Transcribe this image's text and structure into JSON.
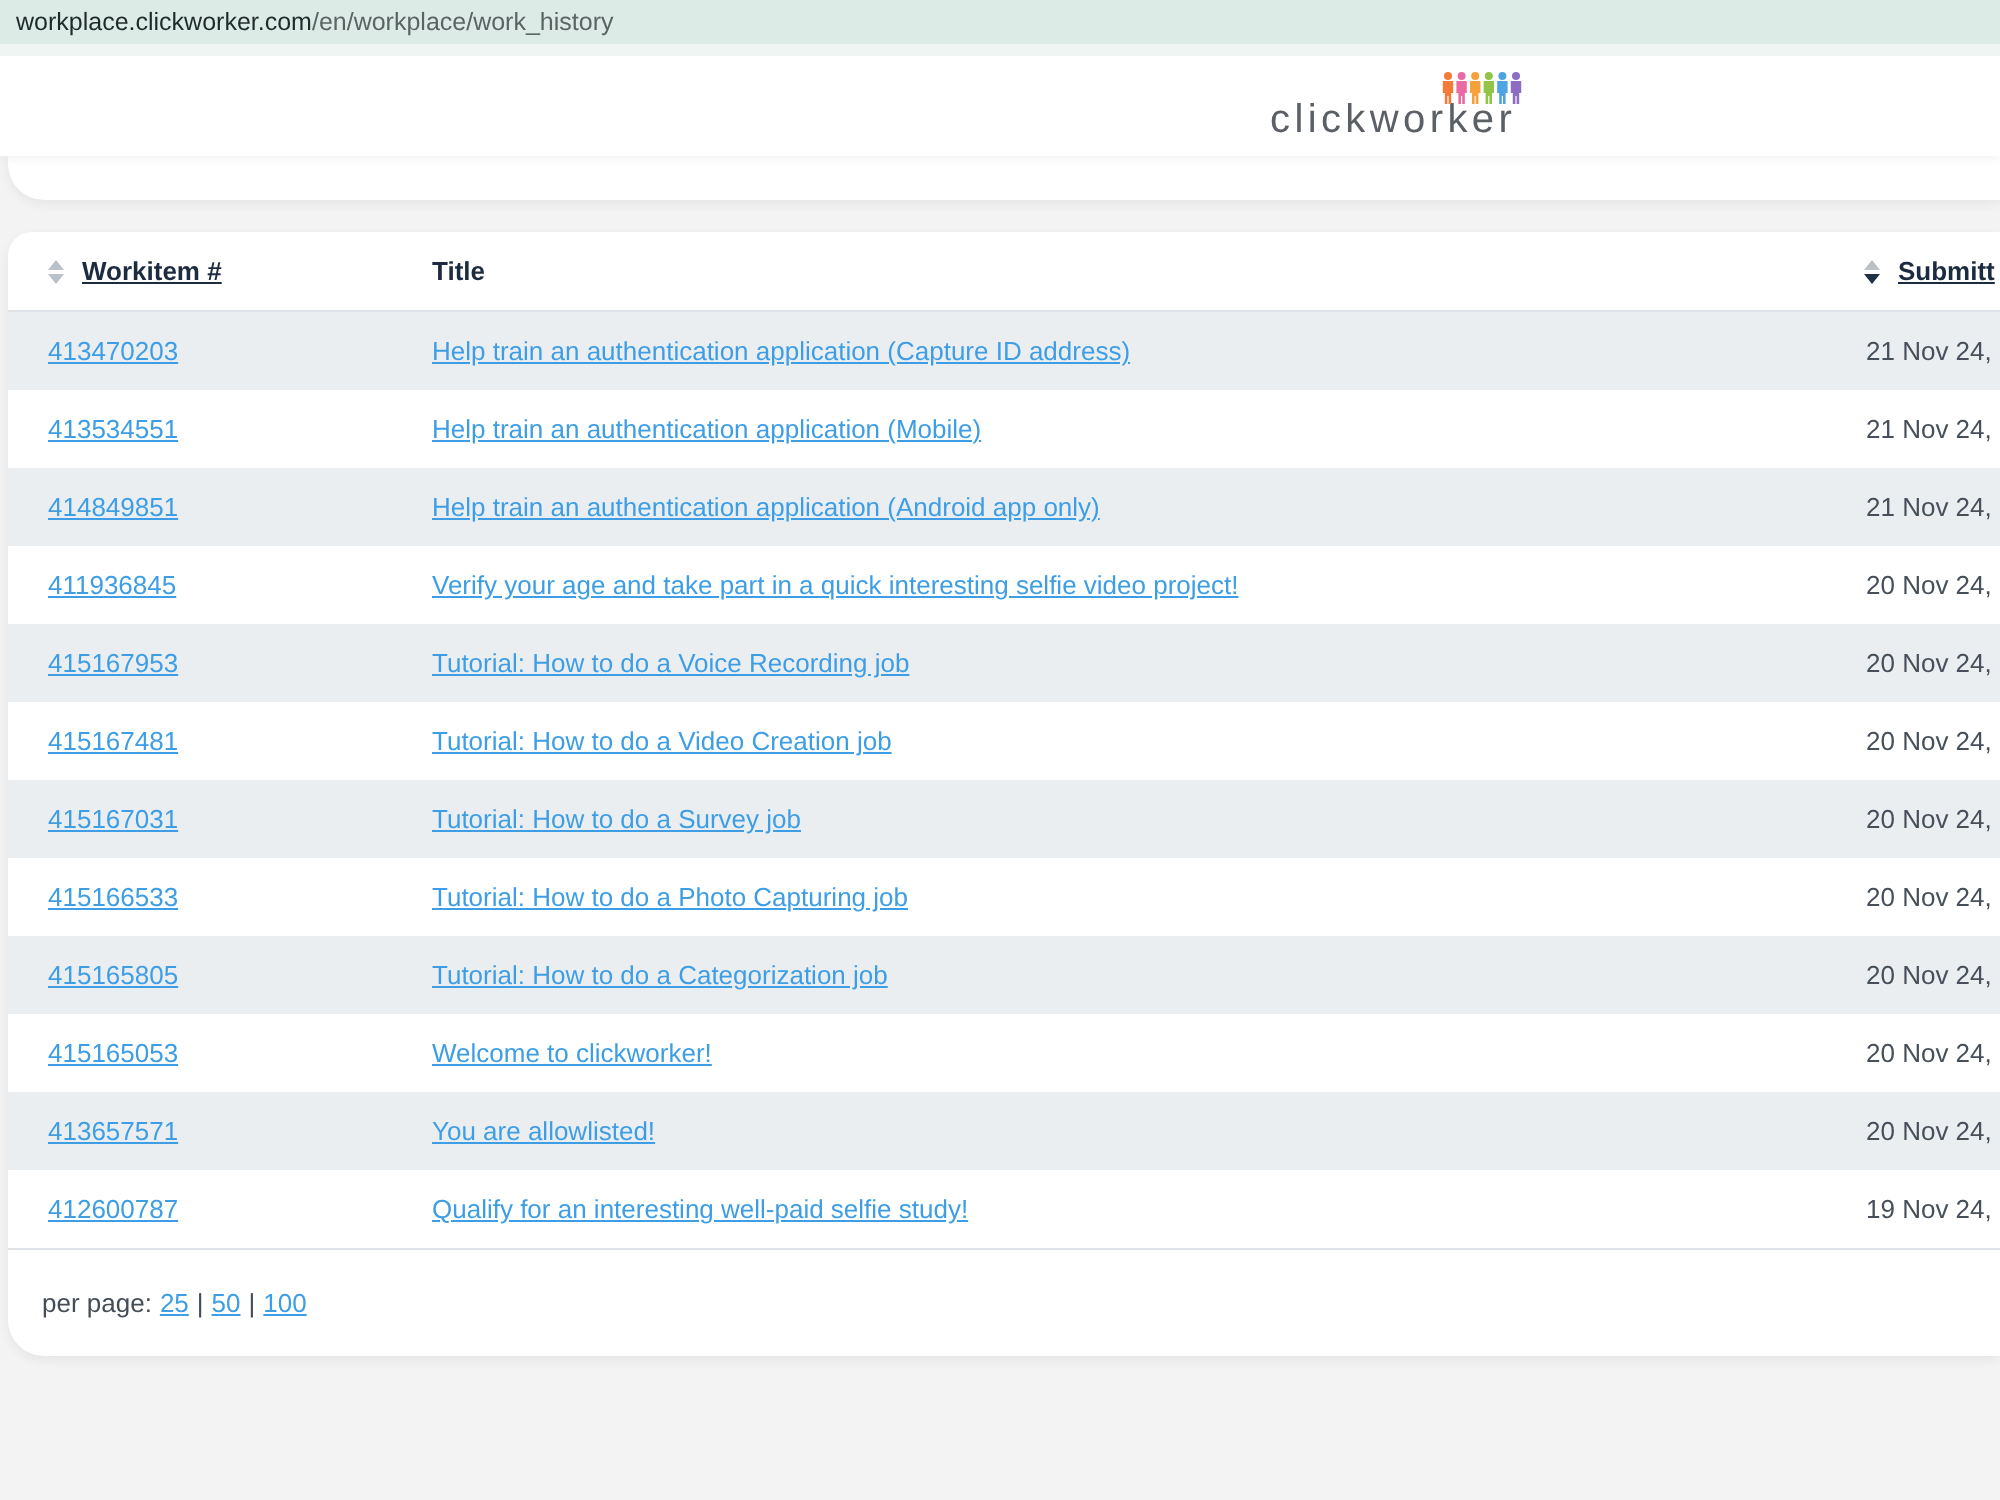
{
  "address_bar": {
    "host": "workplace.clickworker.com",
    "path": "/en/workplace/work_history"
  },
  "header": {
    "logo": "clickworker"
  },
  "table": {
    "columns": [
      {
        "label": "Workitem #",
        "sortable": true,
        "sorted": false
      },
      {
        "label": "Title",
        "sortable": false
      },
      {
        "label": "Submitt",
        "sortable": true,
        "sorted": true
      }
    ],
    "rows": [
      {
        "workitem": "413470203",
        "title": "Help train an authentication application (Capture ID address)",
        "submitted": "21 Nov 24,"
      },
      {
        "workitem": "413534551",
        "title": "Help train an authentication application (Mobile)",
        "submitted": "21 Nov 24,"
      },
      {
        "workitem": "414849851",
        "title": "Help train an authentication application (Android app only)",
        "submitted": "21 Nov 24,"
      },
      {
        "workitem": "411936845",
        "title": "Verify your age and take part in a quick interesting selfie video project!",
        "submitted": "20 Nov 24,"
      },
      {
        "workitem": "415167953",
        "title": "Tutorial: How to do a Voice Recording job",
        "submitted": "20 Nov 24,"
      },
      {
        "workitem": "415167481",
        "title": "Tutorial: How to do a Video Creation job",
        "submitted": "20 Nov 24,"
      },
      {
        "workitem": "415167031",
        "title": "Tutorial: How to do a Survey job",
        "submitted": "20 Nov 24,"
      },
      {
        "workitem": "415166533",
        "title": "Tutorial: How to do a Photo Capturing job",
        "submitted": "20 Nov 24,"
      },
      {
        "workitem": "415165805",
        "title": "Tutorial: How to do a Categorization job",
        "submitted": "20 Nov 24,"
      },
      {
        "workitem": "415165053",
        "title": "Welcome to clickworker!",
        "submitted": "20 Nov 24,"
      },
      {
        "workitem": "413657571",
        "title": "You are allowlisted!",
        "submitted": "20 Nov 24,"
      },
      {
        "workitem": "412600787",
        "title": "Qualify for an interesting well-paid selfie study!",
        "submitted": "19 Nov 24,"
      }
    ]
  },
  "pagination": {
    "label": "per page:",
    "items": [
      {
        "kind": "link",
        "text": "25"
      },
      {
        "kind": "separator",
        "text": "|"
      },
      {
        "kind": "link",
        "text": "50"
      },
      {
        "kind": "separator",
        "text": "|"
      },
      {
        "kind": "link",
        "text": "100"
      }
    ]
  }
}
